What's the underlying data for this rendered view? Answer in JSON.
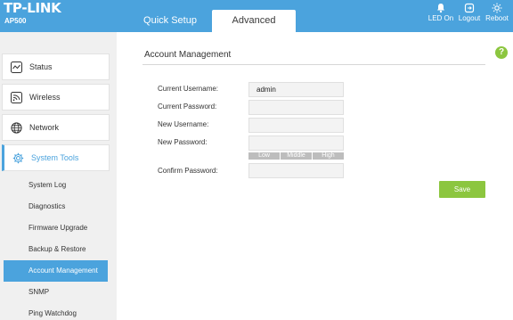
{
  "header": {
    "brand": "TP-LINK",
    "model": "AP500",
    "tabs": [
      {
        "label": "Quick Setup"
      },
      {
        "label": "Advanced"
      }
    ],
    "buttons": [
      {
        "label": "LED On",
        "icon": "bell-icon"
      },
      {
        "label": "Logout",
        "icon": "logout-icon"
      },
      {
        "label": "Reboot",
        "icon": "sun-icon"
      }
    ]
  },
  "sidebar": {
    "items": [
      {
        "label": "Status",
        "icon": "status-chart-icon"
      },
      {
        "label": "Wireless",
        "icon": "wireless-icon"
      },
      {
        "label": "Network",
        "icon": "globe-icon"
      },
      {
        "label": "System Tools",
        "icon": "gear-icon"
      }
    ],
    "subitems": [
      {
        "label": "System Log"
      },
      {
        "label": "Diagnostics"
      },
      {
        "label": "Firmware Upgrade"
      },
      {
        "label": "Backup & Restore"
      },
      {
        "label": "Account Management"
      },
      {
        "label": "SNMP"
      },
      {
        "label": "Ping Watchdog"
      }
    ]
  },
  "main": {
    "help": "?",
    "title": "Account Management",
    "fields": {
      "current_username": {
        "label": "Current Username:",
        "value": "admin"
      },
      "current_password": {
        "label": "Current Password:",
        "value": ""
      },
      "new_username": {
        "label": "New Username:",
        "value": ""
      },
      "new_password": {
        "label": "New Password:",
        "value": ""
      },
      "confirm_password": {
        "label": "Confirm Password:",
        "value": ""
      }
    },
    "strength": [
      "Low",
      "Middle",
      "High"
    ],
    "save_label": "Save"
  },
  "colors": {
    "accent": "#4ba3dd",
    "save": "#8cc63f",
    "help": "#8cc63f"
  }
}
